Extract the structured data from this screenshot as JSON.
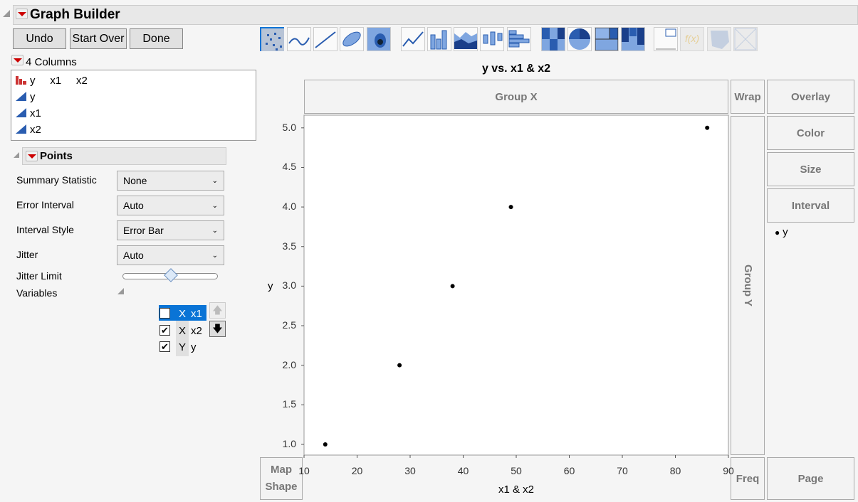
{
  "header": {
    "title": "Graph Builder"
  },
  "buttons": {
    "undo": "Undo",
    "start_over": "Start Over",
    "done": "Done"
  },
  "columns": {
    "title": "4 Columns",
    "items": [
      {
        "label": "y     x1     x2",
        "type": "group"
      },
      {
        "label": "y",
        "type": "continuous"
      },
      {
        "label": "x1",
        "type": "continuous"
      },
      {
        "label": "x2",
        "type": "continuous"
      }
    ]
  },
  "points_panel": {
    "title": "Points",
    "options": [
      {
        "label": "Summary Statistic",
        "value": "None"
      },
      {
        "label": "Error Interval",
        "value": "Auto"
      },
      {
        "label": "Interval Style",
        "value": "Error Bar"
      },
      {
        "label": "Jitter",
        "value": "Auto"
      }
    ],
    "jitter_limit_label": "Jitter Limit",
    "jitter_limit_value": 0.5,
    "variables_label": "Variables",
    "variables": [
      {
        "role": "X",
        "name": "x1",
        "checked": false,
        "selected": true
      },
      {
        "role": "X",
        "name": "x2",
        "checked": true,
        "selected": false
      },
      {
        "role": "Y",
        "name": "y",
        "checked": true,
        "selected": false
      }
    ]
  },
  "toolbar": [
    "points",
    "smoother",
    "line-of-fit",
    "ellipse",
    "contour",
    "line",
    "bar",
    "area",
    "box-plot",
    "histogram",
    "heatmap",
    "pie",
    "treemap",
    "mosaic",
    "caption-box",
    "formula",
    "map-shapes",
    "parallel-plot"
  ],
  "zones": {
    "group_x": "Group X",
    "wrap": "Wrap",
    "overlay": "Overlay",
    "color": "Color",
    "size": "Size",
    "interval": "Interval",
    "group_y": "Group Y",
    "map_shape": "Map\nShape",
    "freq": "Freq",
    "page": "Page"
  },
  "legend": {
    "items": [
      "y"
    ]
  },
  "chart_data": {
    "type": "scatter",
    "title": "y vs. x1 & x2",
    "xlabel": "x1 & x2",
    "ylabel": "y",
    "xlim": [
      10,
      90
    ],
    "ylim": [
      0.865,
      5.16
    ],
    "xticks": [
      "10",
      "20",
      "30",
      "40",
      "50",
      "60",
      "70",
      "80",
      "90"
    ],
    "yticks": [
      "1.0",
      "1.5",
      "2.0",
      "2.5",
      "3.0",
      "3.5",
      "4.0",
      "4.5",
      "5.0"
    ],
    "points": [
      {
        "x": 14,
        "y": 1
      },
      {
        "x": 28,
        "y": 2
      },
      {
        "x": 38,
        "y": 3
      },
      {
        "x": 49,
        "y": 4
      },
      {
        "x": 86,
        "y": 5
      }
    ],
    "legend": "right"
  }
}
